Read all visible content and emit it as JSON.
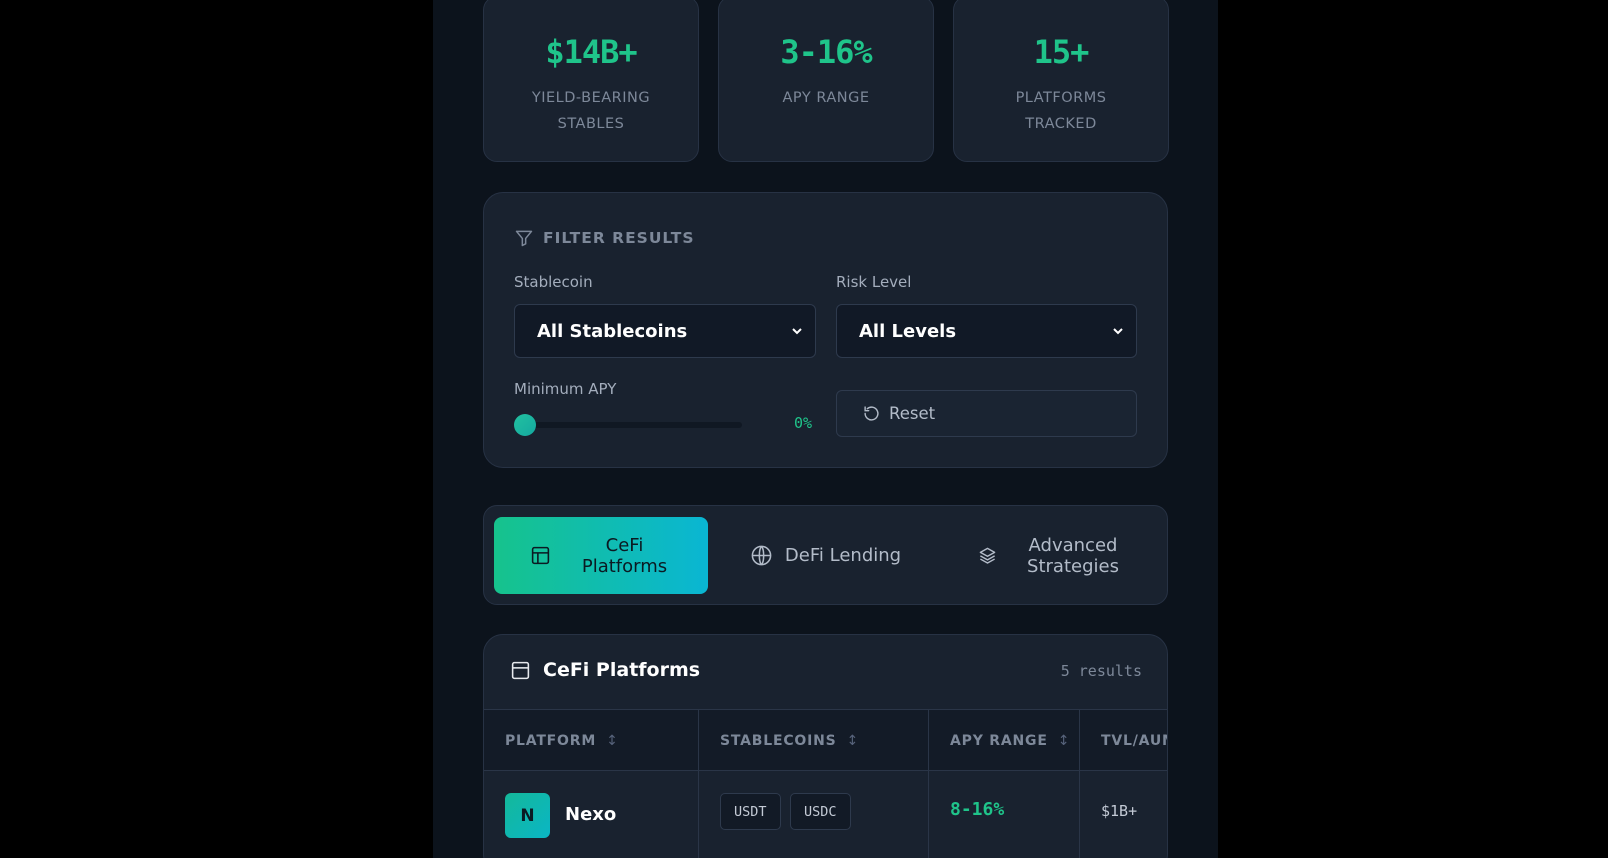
{
  "stats": [
    {
      "value": "$14B+",
      "label": "YIELD-BEARING STABLES"
    },
    {
      "value": "3-16%",
      "label": "APY RANGE"
    },
    {
      "value": "15+",
      "label": "PLATFORMS TRACKED"
    }
  ],
  "filter": {
    "title": "FILTER RESULTS",
    "stablecoin_label": "Stablecoin",
    "stablecoin_value": "All Stablecoins",
    "risk_label": "Risk Level",
    "risk_value": "All Levels",
    "min_apy_label": "Minimum APY",
    "min_apy_value": "0%",
    "min_apy_fraction": 0,
    "reset_label": "Reset"
  },
  "tabs": [
    {
      "label": "CeFi Platforms",
      "icon": "layout-icon",
      "active": true
    },
    {
      "label": "DeFi Lending",
      "icon": "globe-icon",
      "active": false
    },
    {
      "label": "Advanced Strategies",
      "icon": "layers-icon",
      "active": false
    }
  ],
  "table": {
    "title": "CeFi Platforms",
    "count": "5 results",
    "columns": [
      "PLATFORM",
      "STABLECOINS",
      "APY RANGE",
      "TVL/AUM"
    ],
    "rows": [
      {
        "avatar": "N",
        "platform": "Nexo",
        "stablecoins": [
          "USDT",
          "USDC"
        ],
        "apy": "8-16%",
        "tvl": "$1B+"
      }
    ]
  },
  "colors": {
    "accent": "#1fc48a",
    "gradient_start": "#16c38c",
    "gradient_end": "#0ab6d3",
    "panel": "#19222f"
  }
}
